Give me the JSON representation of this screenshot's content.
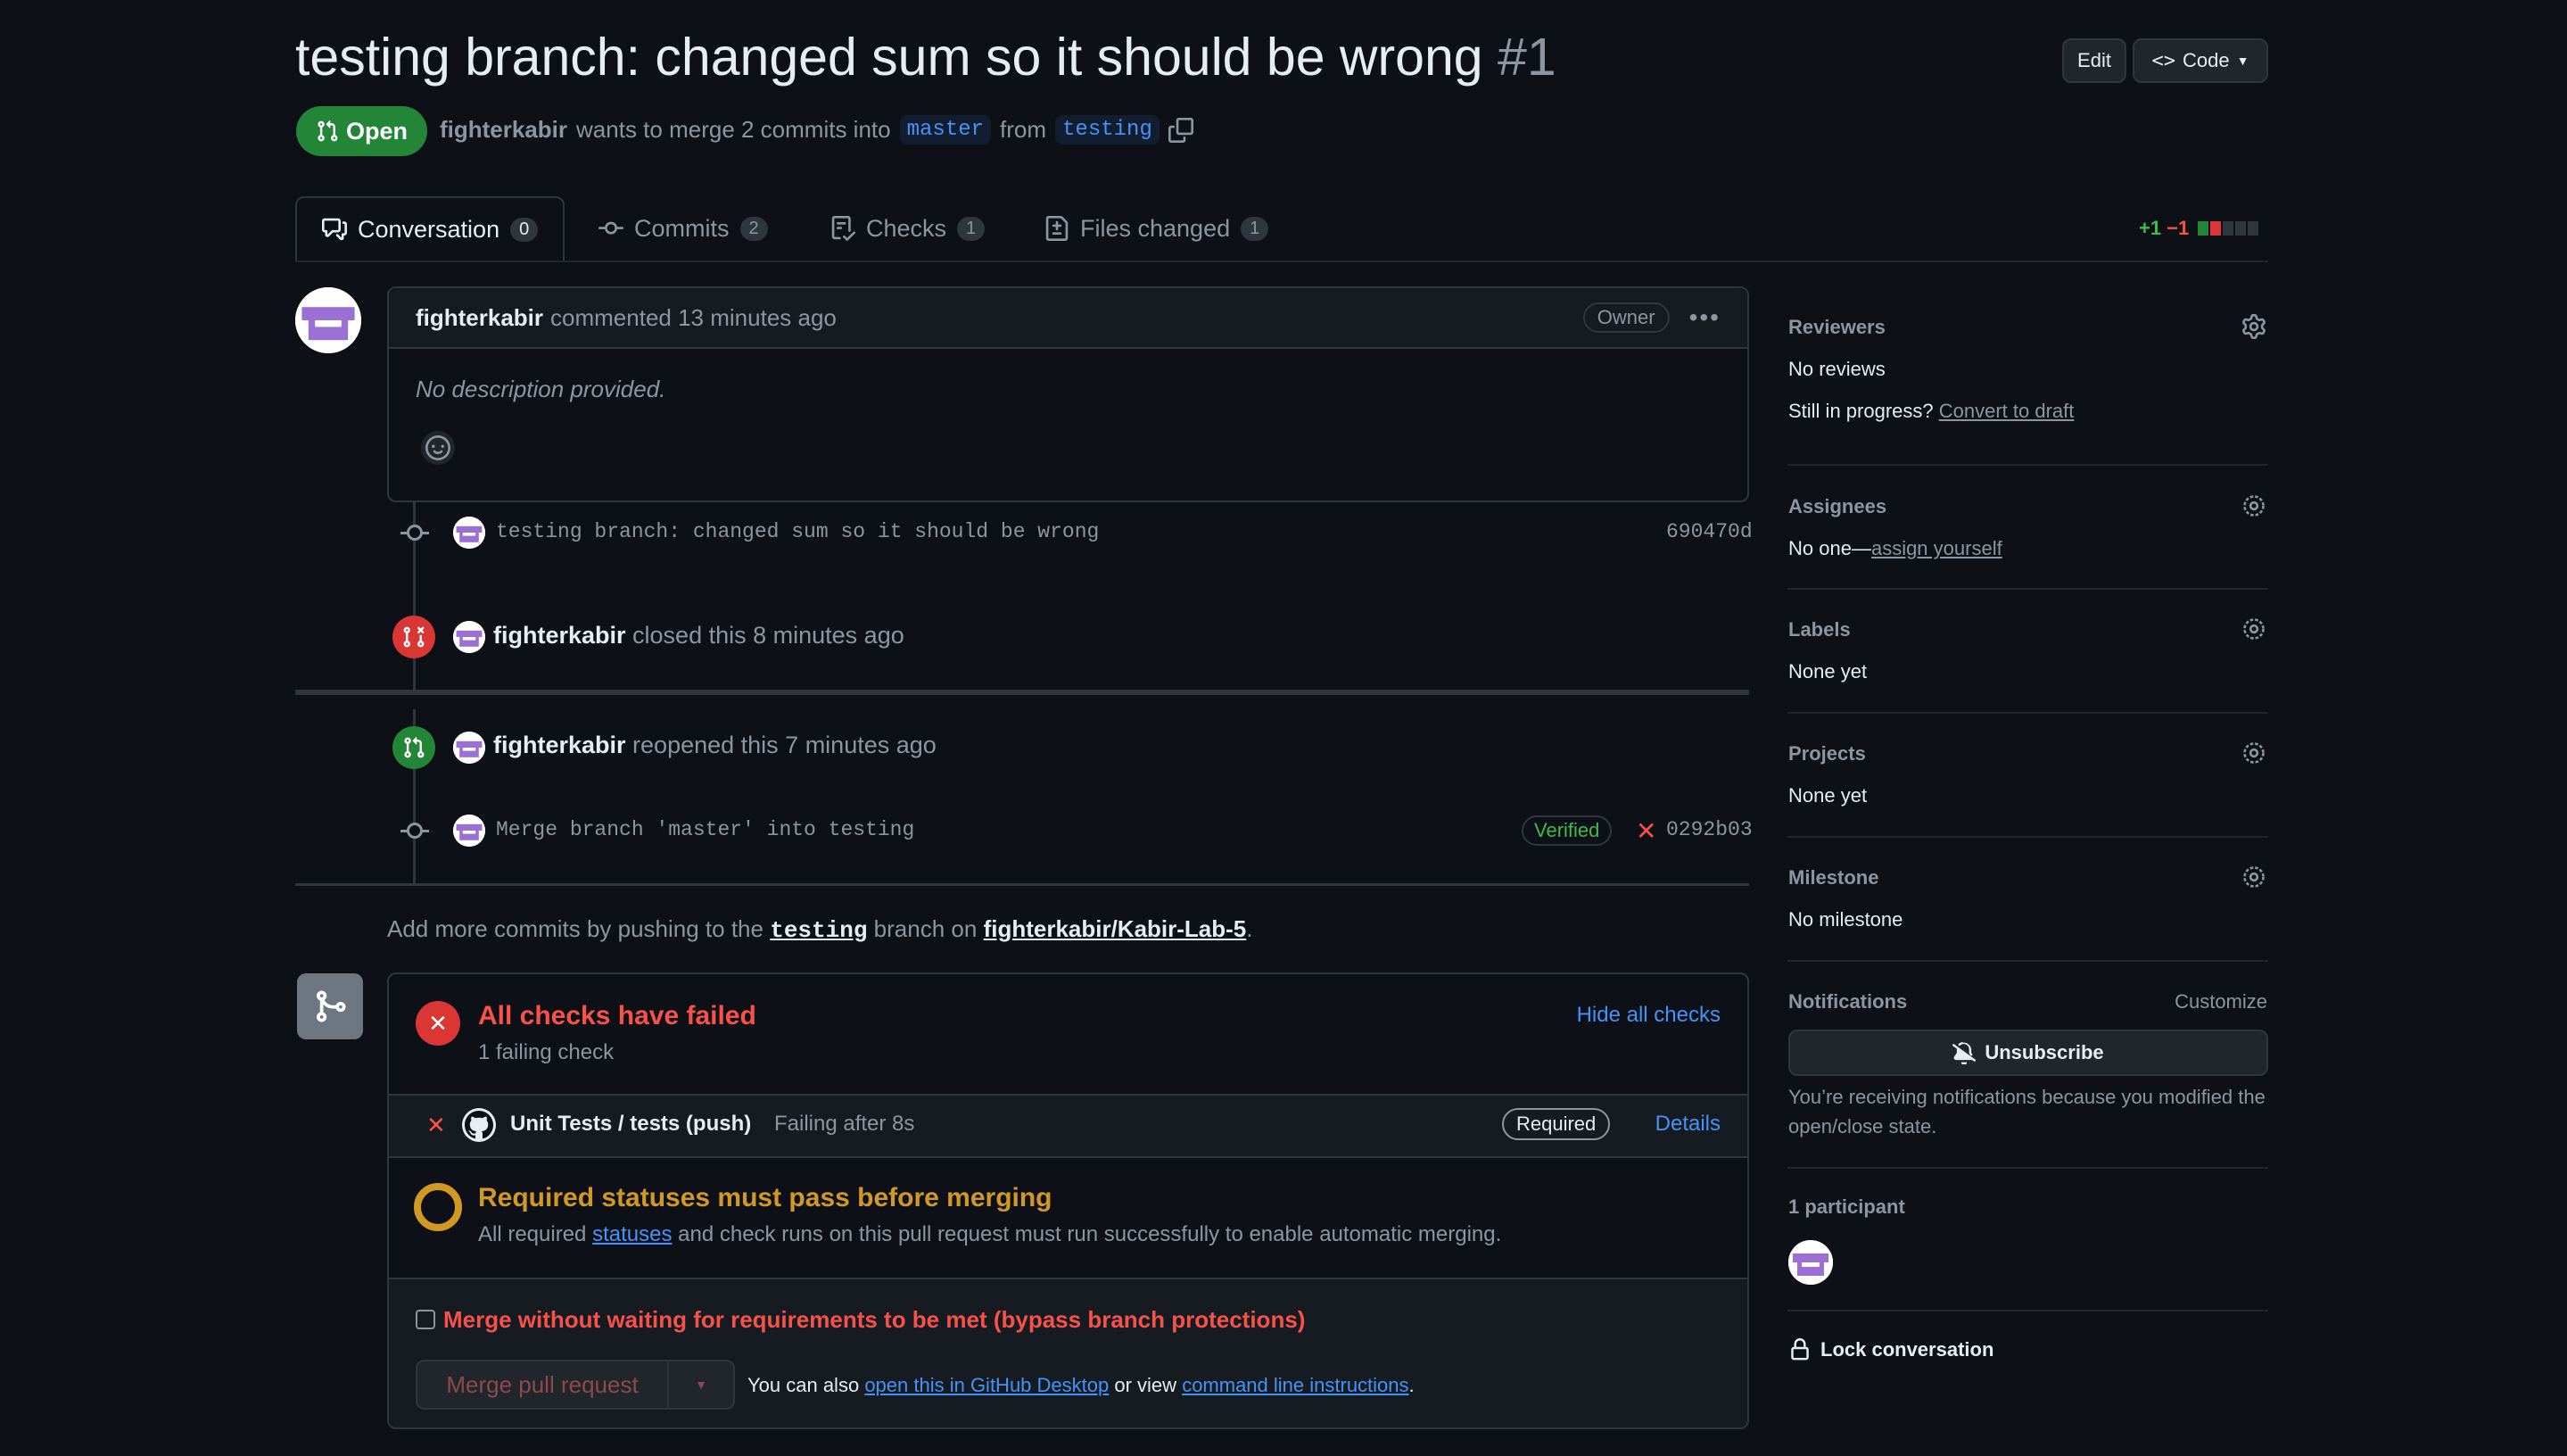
{
  "header": {
    "title": "testing branch: changed sum so it should be wrong",
    "number": "#1",
    "edit_label": "Edit",
    "code_label": "Code",
    "state": "Open",
    "author": "fighterkabir",
    "merge_text": "wants to merge 2 commits into",
    "base_branch": "master",
    "from_text": "from",
    "head_branch": "testing"
  },
  "tabs": [
    {
      "label": "Conversation",
      "count": "0"
    },
    {
      "label": "Commits",
      "count": "2"
    },
    {
      "label": "Checks",
      "count": "1"
    },
    {
      "label": "Files changed",
      "count": "1"
    }
  ],
  "diffstat": {
    "additions": "+1",
    "deletions": "−1"
  },
  "comment": {
    "author": "fighterkabir",
    "action": "commented 13 minutes ago",
    "role": "Owner",
    "body": "No description provided."
  },
  "timeline": {
    "commit1": {
      "message": "testing branch: changed sum so it should be wrong",
      "sha": "690470d"
    },
    "closed": {
      "author": "fighterkabir",
      "text": "closed this 8 minutes ago"
    },
    "reopened": {
      "author": "fighterkabir",
      "text": "reopened this 7 minutes ago"
    },
    "commit2": {
      "message": "Merge branch 'master' into testing",
      "verified": "Verified",
      "sha": "0292b03"
    }
  },
  "push_hint": {
    "prefix": "Add more commits by pushing to the",
    "branch": "testing",
    "middle": "branch on",
    "repo": "fighterkabir/Kabir-Lab-5",
    "suffix": "."
  },
  "checks": {
    "title": "All checks have failed",
    "subtitle": "1 failing check",
    "hide_label": "Hide all checks",
    "check_name": "Unit Tests / tests (push)",
    "check_status": "Failing after 8s",
    "required_badge": "Required",
    "details_label": "Details",
    "req_title": "Required statuses must pass before merging",
    "req_text_prefix": "All required",
    "req_link": "statuses",
    "req_text_suffix": "and check runs on this pull request must run successfully to enable automatic merging.",
    "bypass_label": "Merge without waiting for requirements to be met (bypass branch protections)",
    "merge_button": "Merge pull request",
    "also_text": "You can also",
    "desktop_link": "open this in GitHub Desktop",
    "or_text": "or view",
    "cli_link": "command line instructions",
    "end": "."
  },
  "sidebar": {
    "reviewers": {
      "title": "Reviewers",
      "value": "No reviews",
      "progress_q": "Still in progress?",
      "draft_link": "Convert to draft"
    },
    "assignees": {
      "title": "Assignees",
      "value": "No one—",
      "assign_link": "assign yourself"
    },
    "labels": {
      "title": "Labels",
      "value": "None yet"
    },
    "projects": {
      "title": "Projects",
      "value": "None yet"
    },
    "milestone": {
      "title": "Milestone",
      "value": "No milestone"
    },
    "notifications": {
      "title": "Notifications",
      "customize": "Customize",
      "button": "Unsubscribe",
      "reason": "You’re receiving notifications because you modified the open/close state."
    },
    "participants": {
      "title": "1 participant"
    },
    "lock": "Lock conversation"
  },
  "colors": {
    "accent": "#4493f8",
    "success": "#238636",
    "danger": "#da3633",
    "warning": "#d29922"
  }
}
